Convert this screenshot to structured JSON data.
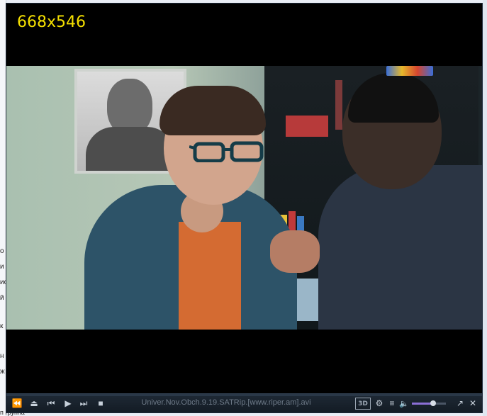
{
  "background_window": {
    "left_edge_chars": [
      "о",
      "и",
      "ио",
      "й",
      "к",
      "н",
      "ж"
    ],
    "bottom_text": "п группа"
  },
  "player": {
    "size_label": "668x546",
    "filename": "Univer.Nov.Obch.9.19.SATRip.[www.riper.am].avi",
    "volume_level": 0.62,
    "controls": {
      "open_label": "⏏",
      "prev_label": "⏮",
      "play_label": "▶",
      "next_label": "⏭",
      "stop_label": "■",
      "stepback_label": "⏪",
      "threed_label": "3D",
      "settings_label": "⚙",
      "playlist_label": "≡",
      "volume_label": "🔈",
      "fullscreen_label": "↗",
      "close_label": "✕"
    }
  },
  "colors": {
    "size_label": "#f5e000",
    "control_bar": "#1a2430",
    "volume_fill": "#8b6fd6"
  }
}
